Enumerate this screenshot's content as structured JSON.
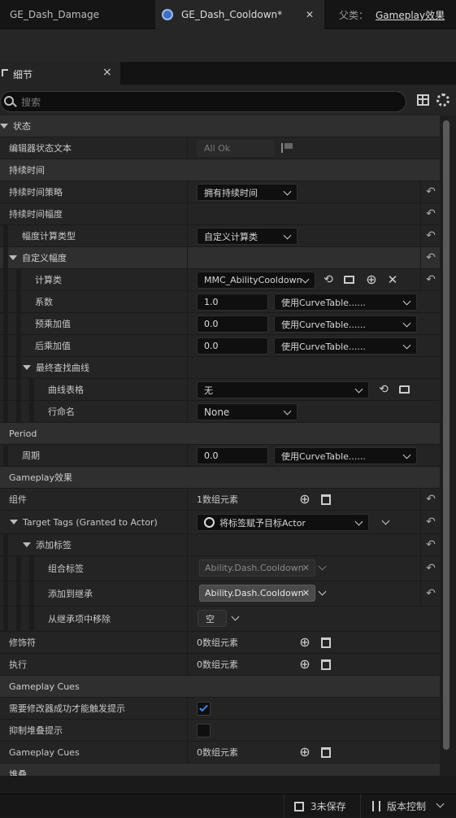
{
  "tabs": {
    "tab1": "GE_Dash_Damage",
    "tab2": "GE_Dash_Cooldown*",
    "close": "✕",
    "parent_label": "父类：",
    "parent_value": "Gameplay效果"
  },
  "panel": {
    "title": "细节",
    "close": "×"
  },
  "search": {
    "placeholder": "搜索"
  },
  "rows": {
    "status_cat": "状态",
    "editor_status_label": "编辑器状态文本",
    "editor_status_value": "All Ok",
    "duration_cat": "持续时间",
    "duration_policy_label": "持续时间策略",
    "duration_policy_value": "拥有持续时间",
    "duration_mag_label": "持续时间幅度",
    "mag_calc_type_label": "幅度计算类型",
    "mag_calc_type_value": "自定义计算类",
    "custom_mag_label": "自定义幅度",
    "calc_class_label": "计算类",
    "calc_class_value": "MMC_AbilityCooldown",
    "coefficient_label": "系数",
    "coefficient_value": "1.0",
    "coefficient_curve": "使用CurveTable......",
    "pre_add_label": "预乘加值",
    "pre_add_value": "0.0",
    "pre_add_curve": "使用CurveTable......",
    "post_add_label": "后乘加值",
    "post_add_value": "0.0",
    "post_add_curve": "使用CurveTable......",
    "final_curve_label": "最终查找曲线",
    "curve_table_label": "曲线表格",
    "curve_table_value": "无",
    "row_name_label": "行命名",
    "row_name_value": "None",
    "period_cat": "Period",
    "period_label": "周期",
    "period_value": "0.0",
    "period_curve": "使用CurveTable......",
    "ge_cat": "Gameplay效果",
    "components_label": "组件",
    "components_value": "1数组元素",
    "target_tags_label": "Target Tags (Granted to Actor)",
    "target_tags_value": "将标签赋予目标Actor",
    "add_tags_label": "添加标签",
    "combined_tags_label": "组合标签",
    "combined_tags_chip": "Ability.Dash.Cooldown",
    "add_inherited_label": "添加到继承",
    "add_inherited_chip": "Ability.Dash.Cooldown",
    "remove_inherited_label": "从继承项中移除",
    "remove_inherited_value": "空",
    "modifiers_label": "修饰符",
    "modifiers_value": "0数组元素",
    "executions_label": "执行",
    "executions_value": "0数组元素",
    "cues_cat": "Gameplay Cues",
    "require_mod_label": "需要修改器成功才能触发提示",
    "suppress_stack_label": "抑制堆叠提示",
    "cues_label": "Gameplay Cues",
    "cues_value": "0数组元素",
    "stacking_cat": "堆叠"
  },
  "status": {
    "save": "3未保存",
    "vcs": "版本控制"
  },
  "icons": {
    "reset": "↶",
    "remove": "✕",
    "add": "⊕",
    "browse": "⟲",
    "chip_remove": "✕"
  },
  "colors": {
    "accent": "#2f7fd6",
    "chip_active": "#4a4a4a",
    "check": "#3d8bfd"
  }
}
